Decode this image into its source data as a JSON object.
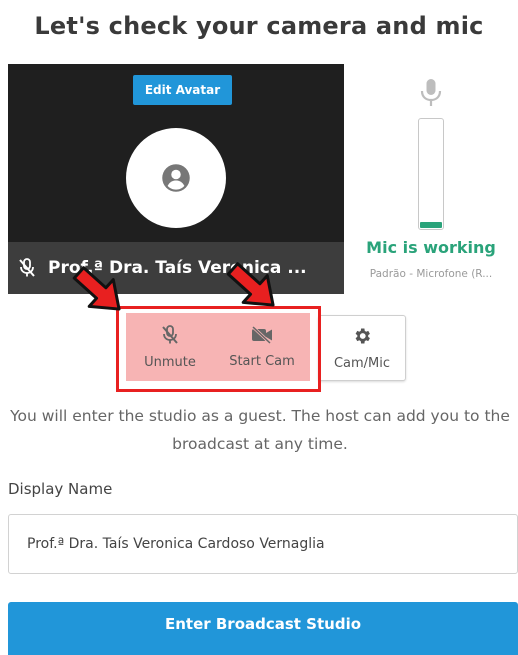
{
  "page": {
    "title": "Let's check your camera and mic"
  },
  "preview": {
    "edit_avatar_label": "Edit Avatar",
    "participant_name": "Prof.ª Dra. Taís Veronica ..."
  },
  "mic": {
    "status": "Mic is working",
    "device": "Padrão - Microfone (R...",
    "level": 0.05
  },
  "controls": {
    "unmute_label": "Unmute",
    "start_cam_label": "Start Cam",
    "cam_mic_label": "Cam/Mic"
  },
  "guest_note": "You will enter the studio as a guest. The host can add you to the broadcast at any time.",
  "display_name": {
    "label": "Display Name",
    "value": "Prof.ª Dra. Taís Veronica Cardoso Vernaglia"
  },
  "enter_button_label": "Enter Broadcast Studio",
  "colors": {
    "accent": "#2196d9",
    "mic_ok": "#2aa37a",
    "highlight": "#e82020",
    "control_bg": "#f7b4b4"
  }
}
